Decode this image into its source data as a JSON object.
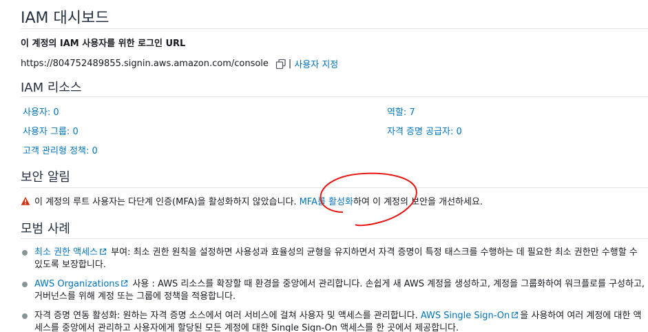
{
  "title": "IAM 대시보드",
  "signin": {
    "heading": "이 계정의 IAM 사용자를 위한 로그인 URL",
    "url": "https://804752489855.signin.aws.amazon.com/console",
    "separator": "|",
    "customize_label": "사용자 지정"
  },
  "resources": {
    "heading": "IAM 리소스",
    "items": [
      {
        "label": "사용자: 0"
      },
      {
        "label": "사용자 그룹: 0"
      },
      {
        "label": "고객 관리형 정책: 0"
      },
      {
        "label": "역할: 7"
      },
      {
        "label": "자격 증명 공급자: 0"
      }
    ]
  },
  "security_alerts": {
    "heading": "보안 알림",
    "text_before": "이 계정의 루트 사용자는 다단계 인증(MFA)을 활성화하지 않았습니다.",
    "link": "MFA를 활성화",
    "text_after": "하여 이 계정의 보안을 개선하세요.",
    "warning_color": "#d13212",
    "annotation_color": "#e8130f"
  },
  "best_practices": {
    "heading": "모범 사례",
    "items": [
      {
        "link": "최소 권한 액세스",
        "text": " 부여: 최소 권한 원칙을 설정하면 사용성과 효율성의 균형을 유지하면서 자격 증명이 특정 태스크를 수행하는 데 필요한 최소 권한만 수행할 수 있도록 보장합니다."
      },
      {
        "link": "AWS Organizations",
        "text": " 사용 : AWS 리소스를 확장할 때 환경을 중앙에서 관리합니다. 손쉽게 새 AWS 계정을 생성하고, 계정을 그룹화하여 워크플로를 구성하고, 거버넌스를 위해 계정 또는 그룹에 정책을 적용합니다."
      },
      {
        "text_before": "자격 증명 연동 활성화: 원하는 자격 증명 소스에서 여러 서비스에 걸쳐 사용자 및 액세스를 관리합니다. ",
        "link": "AWS Single Sign-On",
        "text": "을 사용하여 여러 계정에 대한 액세스를 중앙에서 관리하고 사용자에게 할당된 모든 계정에 대한 Single Sign-On 액세스를 한 곳에서 제공합니다."
      }
    ]
  },
  "icons": {
    "copy": "copy-icon",
    "warning": "warning-icon",
    "external": "external-link-icon"
  },
  "colors": {
    "link": "#0073bb",
    "heading": "#232f3e",
    "divider": "#e5e5e5"
  }
}
